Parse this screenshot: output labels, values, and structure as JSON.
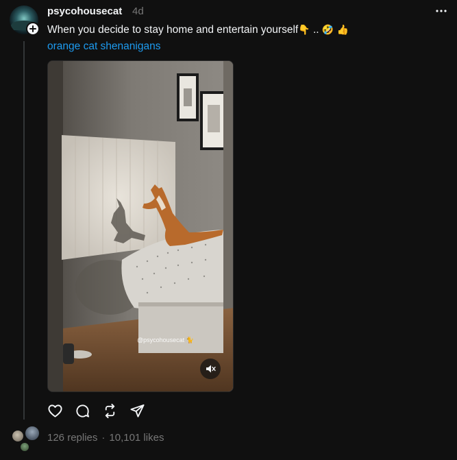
{
  "post": {
    "username": "psycohousecat",
    "timestamp": "4d",
    "caption": "When you decide to stay home and entertain yourself",
    "caption_emojis": [
      "👇",
      "..",
      "🤣",
      "👍"
    ],
    "topic": "orange cat shenanigans",
    "video_watermark": "@psycohousecat 🐈",
    "replies_label": "126 replies",
    "separator": "·",
    "likes_label": "10,101 likes"
  },
  "icons": {
    "avatar": "profile-avatar",
    "follow": "plus-icon",
    "more": "more-horizontal-icon",
    "mute": "speaker-muted-icon",
    "like": "heart-icon",
    "reply": "comment-bubble-icon",
    "repost": "repost-icon",
    "share": "send-icon"
  },
  "colors": {
    "background": "#101010",
    "text_primary": "#f3f5f7",
    "text_secondary": "#777777",
    "link": "#1d9bf0",
    "thread_line": "#333638"
  }
}
